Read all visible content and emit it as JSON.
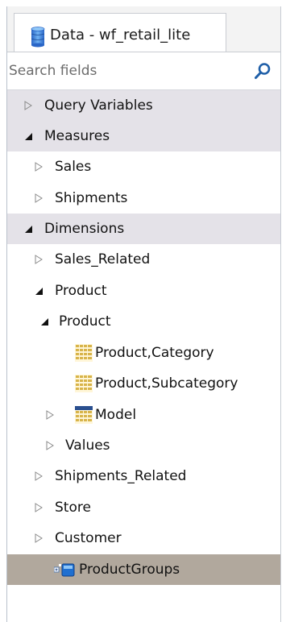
{
  "panel": {
    "tab_title": "Data - wf_retail_lite",
    "search_placeholder": "Search fields"
  },
  "tree": {
    "query_variables": "Query Variables",
    "measures": "Measures",
    "sales": "Sales",
    "shipments": "Shipments",
    "dimensions": "Dimensions",
    "sales_related": "Sales_Related",
    "product_1": "Product",
    "product_2": "Product",
    "product_category": "Product,Category",
    "product_subcategory": "Product,Subcategory",
    "model": "Model",
    "values": "Values",
    "shipments_related": "Shipments_Related",
    "store": "Store",
    "customer": "Customer",
    "product_groups": "ProductGroups"
  },
  "colors": {
    "section_header_bg": "#e4e2e8",
    "selected_row_bg": "#b1a89d",
    "search_icon": "#1f5fa8"
  },
  "icons": {
    "tab": "database-icon",
    "search": "search-icon",
    "expanded": "triangle-down-icon",
    "collapsed": "triangle-right-icon",
    "field": "grid-icon",
    "group": "product-groups-icon"
  }
}
